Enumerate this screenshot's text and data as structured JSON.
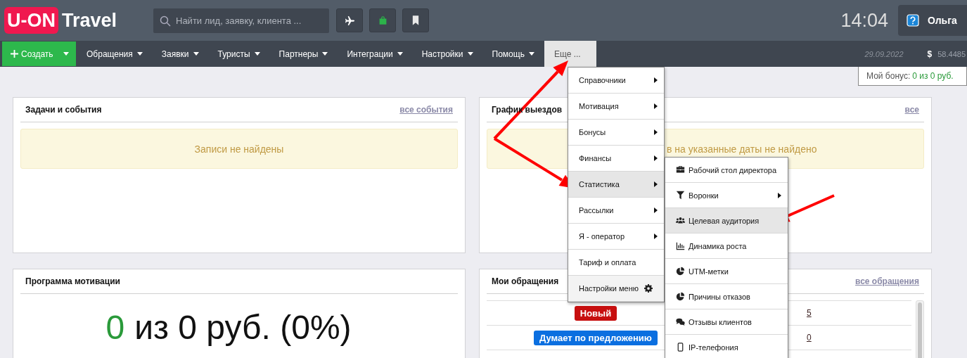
{
  "header": {
    "logo": {
      "mark": "U-ON",
      "text": "Travel"
    },
    "search": {
      "placeholder": "Найти лид, заявку, клиента ..."
    },
    "time": "14:04",
    "user": {
      "name": "Ольга"
    }
  },
  "nav": {
    "create_button": {
      "label": "Создать"
    },
    "items": [
      {
        "label": "Обращения",
        "selected": false,
        "kind": "dropdown"
      },
      {
        "label": "Заявки",
        "selected": false,
        "kind": "dropdown"
      },
      {
        "label": "Туристы",
        "selected": false,
        "kind": "dropdown"
      },
      {
        "label": "Партнеры",
        "selected": false,
        "kind": "dropdown"
      },
      {
        "label": "Интеграции",
        "selected": false,
        "kind": "dropdown"
      },
      {
        "label": "Настройки",
        "selected": false,
        "kind": "dropdown"
      },
      {
        "label": "Помощь",
        "selected": false,
        "kind": "dropdown"
      },
      {
        "label": "Еще ...",
        "selected": true,
        "kind": "plain"
      }
    ],
    "date": "29.09.2022",
    "currency": {
      "symbol": "$",
      "rate": "58.4485"
    }
  },
  "bonus": {
    "label": "Мой бонус:",
    "value": "0 из 0 руб."
  },
  "cards": [
    {
      "kind": "alert",
      "title": "Задачи и события",
      "link": "все события",
      "message": "Записи не найдены"
    },
    {
      "kind": "alert",
      "title": "График выездов",
      "link": "все",
      "message": "в на указанные даты не найдено"
    },
    {
      "kind": "motivation",
      "title": "Программа мотивации",
      "amount": "0",
      "rest": "из 0 руб. (0%)"
    },
    {
      "kind": "requests",
      "title": "Мои обращения",
      "link": "все обращения",
      "rows": [
        {
          "status": "Новый",
          "color": "#c70f0f",
          "count": "5"
        },
        {
          "status": "Думает по предложению",
          "color": "#0b6fe0",
          "count": "0"
        }
      ]
    }
  ],
  "dropdown": {
    "items": [
      {
        "label": "Справочники",
        "kind": "submenu",
        "selected": false
      },
      {
        "label": "Мотивация",
        "kind": "submenu",
        "selected": false
      },
      {
        "label": "Бонусы",
        "kind": "submenu",
        "selected": false
      },
      {
        "label": "Финансы",
        "kind": "submenu",
        "selected": false
      },
      {
        "label": "Статистика",
        "kind": "submenu",
        "selected": true
      },
      {
        "label": "Рассылки",
        "kind": "submenu",
        "selected": false
      },
      {
        "label": "Я - оператор",
        "kind": "submenu",
        "selected": false
      },
      {
        "label": "Тариф и оплата",
        "kind": "plain",
        "selected": false
      },
      {
        "label": "Настройки меню",
        "kind": "settings",
        "selected": false
      }
    ],
    "submenu": [
      {
        "label": "Рабочий стол директора",
        "kind": "plain",
        "selected": false
      },
      {
        "label": "Воронки",
        "kind": "submenu",
        "selected": false
      },
      {
        "label": "Целевая аудитория",
        "kind": "plain",
        "selected": true
      },
      {
        "label": "Динамика роста",
        "kind": "plain",
        "selected": false
      },
      {
        "label": "UTM-метки",
        "kind": "plain",
        "selected": false
      },
      {
        "label": "Причины отказов",
        "kind": "plain",
        "selected": false
      },
      {
        "label": "Отзывы клиентов",
        "kind": "plain",
        "selected": false
      },
      {
        "label": "IP-телефония",
        "kind": "plain",
        "selected": false
      }
    ]
  }
}
